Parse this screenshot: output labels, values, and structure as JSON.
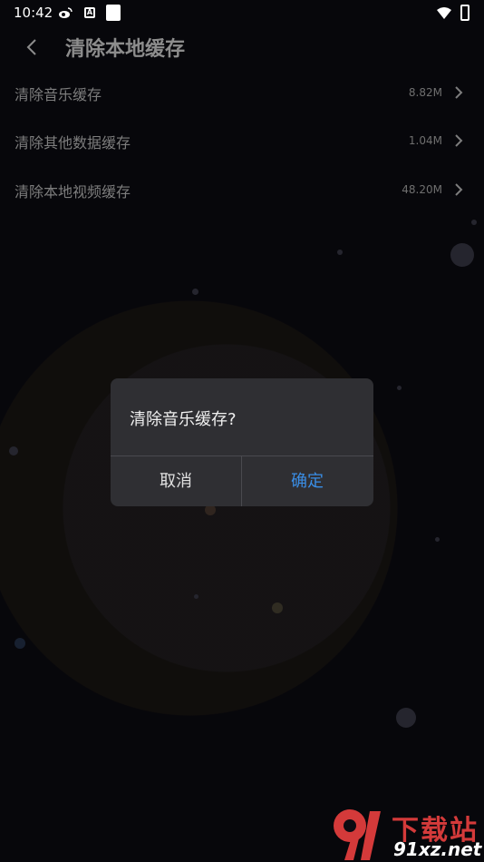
{
  "status_bar": {
    "time": "10:42"
  },
  "header": {
    "title": "清除本地缓存"
  },
  "cache_items": [
    {
      "label": "清除音乐缓存",
      "size": "8.82M"
    },
    {
      "label": "清除其他数据缓存",
      "size": "1.04M"
    },
    {
      "label": "清除本地视频缓存",
      "size": "48.20M"
    }
  ],
  "dialog": {
    "message": "清除音乐缓存?",
    "cancel_label": "取消",
    "confirm_label": "确定"
  },
  "watermark": {
    "line1": "下载站",
    "line2": "91xz.net"
  },
  "colors": {
    "confirm": "#3a8ee6",
    "background": "#0c0b12",
    "dialog": "#2f2f33"
  },
  "icons": [
    "weibo-icon",
    "a-notification-icon",
    "notification-icon",
    "wifi-icon",
    "battery-icon",
    "back-arrow-icon",
    "chevron-right-icon"
  ]
}
